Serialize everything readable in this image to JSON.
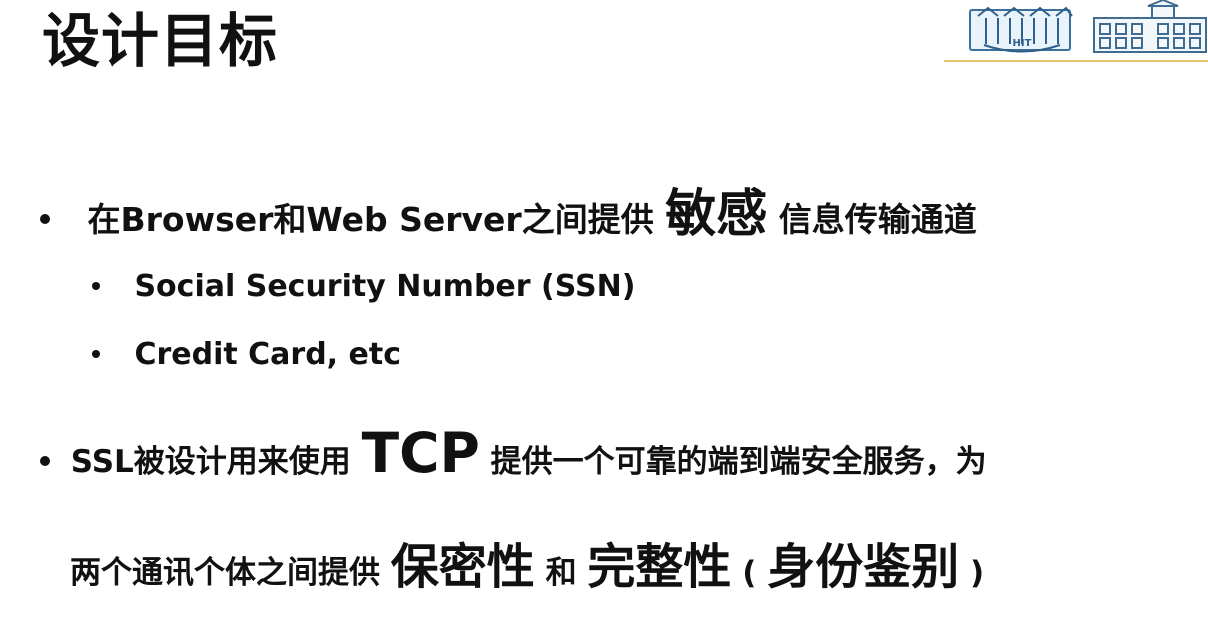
{
  "slide": {
    "title": "设计目标",
    "logo": {
      "seal_text": "HIT"
    },
    "bullets": [
      {
        "before": "在Browser和Web Server之间提供",
        "emphasis": "敏感",
        "after": "信息传输通道",
        "subitems": [
          "Social Security Number (SSN)",
          "Credit Card, etc"
        ]
      },
      {
        "line1_before": "SSL被设计用来使用",
        "line1_emphasis": "TCP",
        "line1_after": "提供一个可靠的端到端安全服务，为",
        "line2_before": "两个通讯个体之间提供",
        "line2_emphasis_1": "保密性",
        "line2_middle": "和",
        "line2_emphasis_2": "完整性",
        "line2_paren_open": "(",
        "line2_emphasis_3": "身份鉴别",
        "line2_paren_close": ")"
      }
    ]
  }
}
